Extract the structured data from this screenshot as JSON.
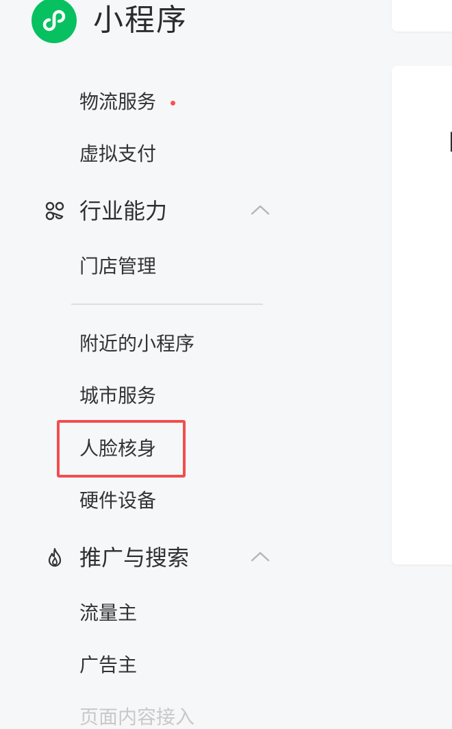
{
  "header": {
    "title": "小程序",
    "logo_icon": "miniprogram-logo-icon",
    "logo_color": "#07c160"
  },
  "sidebar": {
    "items_top": [
      {
        "label": "物流服务",
        "has_dot": true
      },
      {
        "label": "虚拟支付"
      }
    ],
    "industry": {
      "label": "行业能力",
      "icon": "nodes-icon",
      "expanded": true,
      "items": [
        "门店管理",
        "附近的小程序",
        "城市服务",
        "人脸核身",
        "硬件设备"
      ]
    },
    "promotion": {
      "label": "推广与搜索",
      "icon": "flame-icon",
      "expanded": true,
      "items": [
        "流量主",
        "广告主",
        "页面内容接入"
      ]
    },
    "highlighted_item": "人脸核身",
    "highlight_color": "#f24d4d",
    "dot_color": "#fa5151"
  }
}
